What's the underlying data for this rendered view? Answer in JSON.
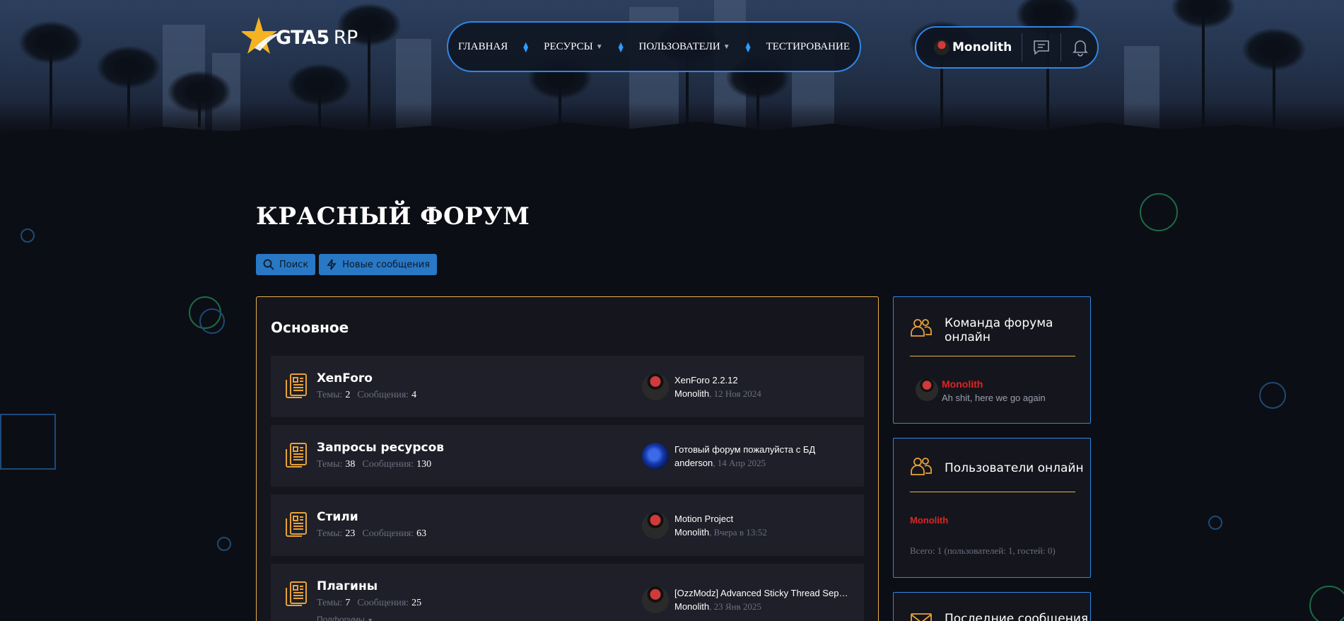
{
  "brand": {
    "logo_bold": "GTA5",
    "logo_thin": "RP"
  },
  "nav": {
    "items": [
      {
        "label": "ГЛАВНАЯ",
        "dropdown": false
      },
      {
        "label": "РЕСУРСЫ",
        "dropdown": true
      },
      {
        "label": "ПОЛЬЗОВАТЕЛИ",
        "dropdown": true
      },
      {
        "label": "ТЕСТИРОВАНИЕ",
        "dropdown": false
      }
    ]
  },
  "user": {
    "name": "Monolith"
  },
  "page": {
    "title": "КРАСНЫЙ ФОРУМ",
    "buttons": {
      "search": "Поиск",
      "new_posts": "Новые сообщения"
    }
  },
  "main_block": {
    "title": "Основное",
    "stats_labels": {
      "threads": "Темы:",
      "messages": "Сообщения:"
    },
    "nodes": [
      {
        "name": "XenForo",
        "threads": "2",
        "messages": "4",
        "last_title": "XenForo 2.2.12",
        "last_user": "Monolith",
        "last_date": ", 12 Ноя 2024",
        "avatar": "monolith"
      },
      {
        "name": "Запросы ресурсов",
        "threads": "38",
        "messages": "130",
        "last_title": "Готовый форум пожалуйста с БД",
        "last_user": "anderson",
        "last_date": ", 14 Апр 2025",
        "avatar": "blue"
      },
      {
        "name": "Стили",
        "threads": "23",
        "messages": "63",
        "last_title": "Motion Project",
        "last_user": "Monolith",
        "last_date": ", Вчера в 13:52",
        "avatar": "monolith"
      },
      {
        "name": "Плагины",
        "threads": "7",
        "messages": "25",
        "last_title": "[OzzModz] Advanced Sticky Thread Sepa...",
        "last_user": "Monolith",
        "last_date": ", 23 Янв 2025",
        "avatar": "monolith",
        "subforums": "Подфорумы"
      }
    ]
  },
  "sidebar": {
    "staff": {
      "title_line1": "Команда форума",
      "title_line2": "онлайн",
      "member_name": "Monolith",
      "member_status": "Ah shit, here we go again"
    },
    "online": {
      "title": "Пользователи онлайн",
      "member_name": "Monolith",
      "total": "Всего: 1 (пользователей: 1, гостей: 0)"
    },
    "latest": {
      "title": "Последние сообщения"
    }
  },
  "colors": {
    "accent_blue": "#2f86e6",
    "accent_gold": "#e8b04a",
    "staff_red": "#e02424",
    "background": "#0c0e15"
  }
}
